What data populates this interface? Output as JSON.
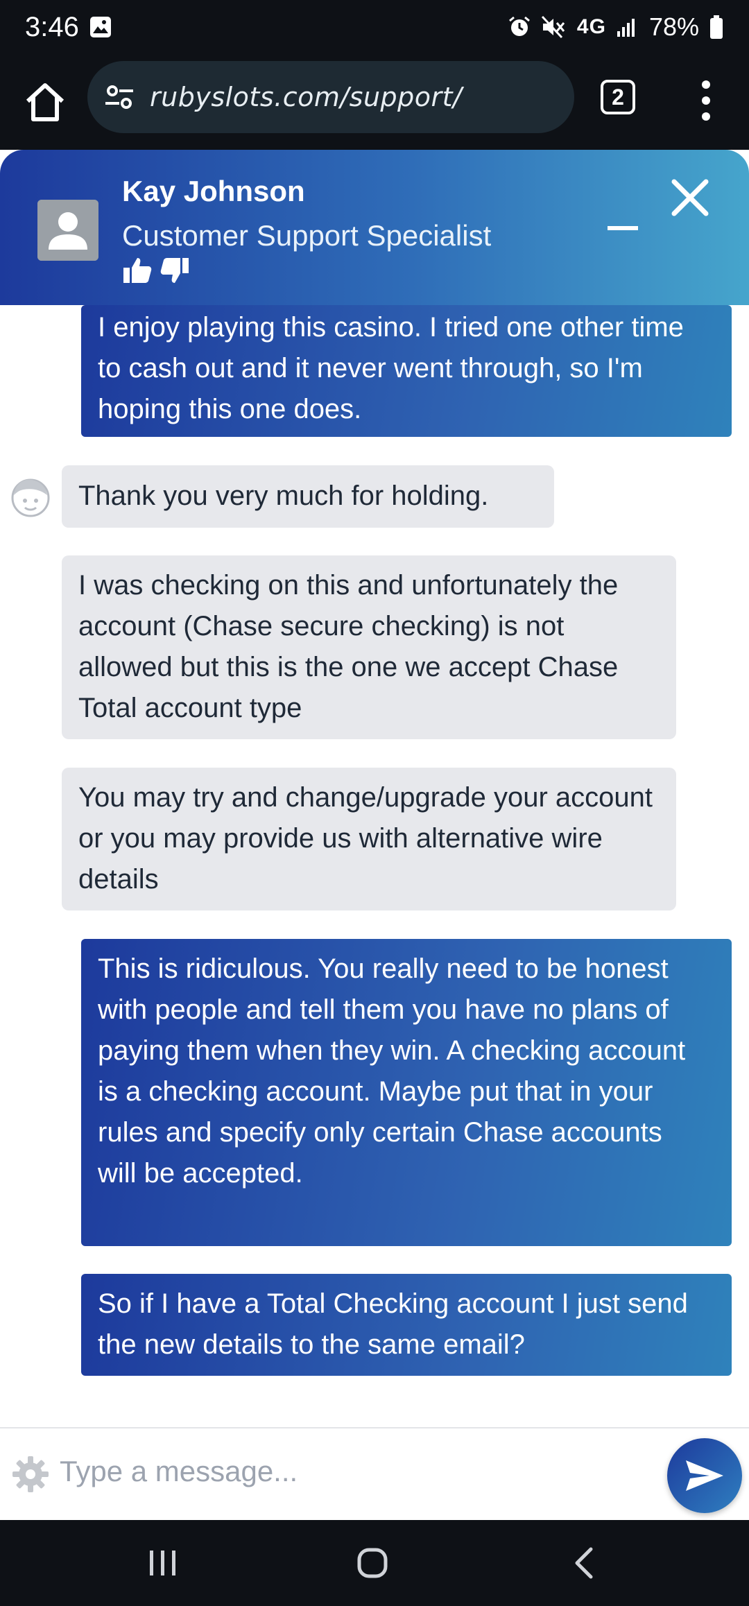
{
  "status_bar": {
    "time": "3:46",
    "network": "4G",
    "battery": "78%"
  },
  "browser": {
    "url": "rubyslots.com/support/",
    "tab_count": "2"
  },
  "chat_header": {
    "agent_name": "Kay Johnson",
    "agent_role": "Customer Support Specialist"
  },
  "messages": [
    {
      "sender": "user",
      "text": "I enjoy playing this casino. I tried one other time to cash out and it never went through, so I'm hoping this one does."
    },
    {
      "sender": "agent",
      "text": "Thank you very much for holding."
    },
    {
      "sender": "agent",
      "text": "I was checking on this and unfortunately the account (Chase secure checking) is not allowed but this is the one we accept Chase Total account type"
    },
    {
      "sender": "agent",
      "text": "You may try and change/upgrade your account or you may provide us with alternative wire details"
    },
    {
      "sender": "user",
      "text": "This is ridiculous. You really need to be honest with people and tell them you have no plans of paying them when they win. A checking account is a checking account. Maybe put that in your rules and specify only certain Chase accounts will be accepted."
    },
    {
      "sender": "user",
      "text": "So if I have a Total Checking account I just send the new details to the same email?"
    }
  ],
  "composer": {
    "placeholder": "Type a message...",
    "value": ""
  },
  "colors": {
    "header_start": "#1d3a9c",
    "header_end": "#46a5cc",
    "user_bubble": "#2f63b2",
    "agent_bubble": "#e7e8ec",
    "system_bar": "#0e1116"
  },
  "icons": [
    "home-icon",
    "site-settings-icon",
    "tab-switcher-icon",
    "more-menu-icon",
    "avatar-icon",
    "thumbs-up-icon",
    "thumbs-down-icon",
    "minimize-icon",
    "close-icon",
    "agent-face-icon",
    "gear-icon",
    "send-icon",
    "recents-icon",
    "nav-home-icon",
    "back-icon"
  ]
}
